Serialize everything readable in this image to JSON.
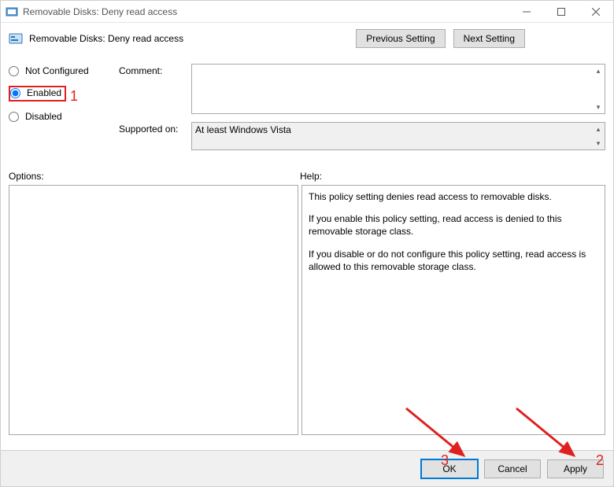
{
  "window": {
    "title": "Removable Disks: Deny read access"
  },
  "policy": {
    "title": "Removable Disks: Deny read access"
  },
  "nav": {
    "prev": "Previous Setting",
    "next": "Next Setting"
  },
  "state": {
    "not_configured": "Not Configured",
    "enabled": "Enabled",
    "disabled": "Disabled",
    "selected": "enabled"
  },
  "form": {
    "comment_label": "Comment:",
    "comment_value": "",
    "supported_label": "Supported on:",
    "supported_value": "At least Windows Vista"
  },
  "lower": {
    "options_label": "Options:",
    "help_label": "Help:"
  },
  "help": {
    "p1": "This policy setting denies read access to removable disks.",
    "p2": "If you enable this policy setting, read access is denied to this removable storage class.",
    "p3": "If you disable or do not configure this policy setting, read access is allowed to this removable storage class."
  },
  "buttons": {
    "ok": "OK",
    "cancel": "Cancel",
    "apply": "Apply"
  },
  "annotations": {
    "n1": "1",
    "n2": "2",
    "n3": "3"
  }
}
